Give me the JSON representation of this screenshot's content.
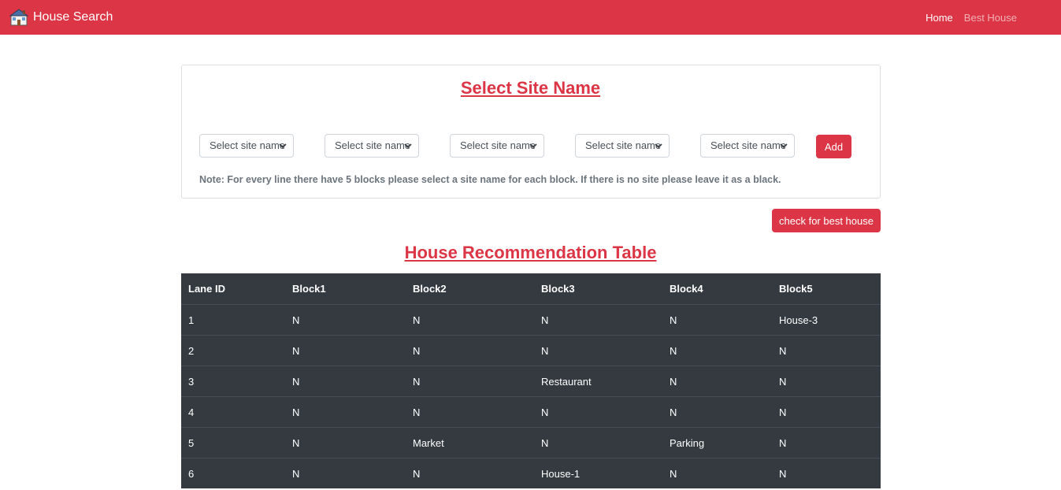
{
  "navbar": {
    "brand": "House Search",
    "brand_icon": "house-icon",
    "links": [
      {
        "label": "Home",
        "active": true
      },
      {
        "label": "Best House",
        "active": false
      }
    ],
    "color": "#dc3545"
  },
  "site_form": {
    "title": "Select Site Name",
    "selects": [
      {
        "value": "Select site name"
      },
      {
        "value": "Select site name"
      },
      {
        "value": "Select site name"
      },
      {
        "value": "Select site name"
      },
      {
        "value": "Select site name"
      }
    ],
    "add_label": "Add",
    "note": "Note: For every line there have 5 blocks please select a site name for each block. If there is no site please leave it as a black."
  },
  "check_label": "check for best house",
  "table": {
    "title": "House Recommendation Table",
    "headers": [
      "Lane ID",
      "Block1",
      "Block2",
      "Block3",
      "Block4",
      "Block5"
    ],
    "rows": [
      [
        "1",
        "N",
        "N",
        "N",
        "N",
        "House-3"
      ],
      [
        "2",
        "N",
        "N",
        "N",
        "N",
        "N"
      ],
      [
        "3",
        "N",
        "N",
        "Restaurant",
        "N",
        "N"
      ],
      [
        "4",
        "N",
        "N",
        "N",
        "N",
        "N"
      ],
      [
        "5",
        "N",
        "Market",
        "N",
        "Parking",
        "N"
      ],
      [
        "6",
        "N",
        "N",
        "House-1",
        "N",
        "N"
      ]
    ]
  }
}
